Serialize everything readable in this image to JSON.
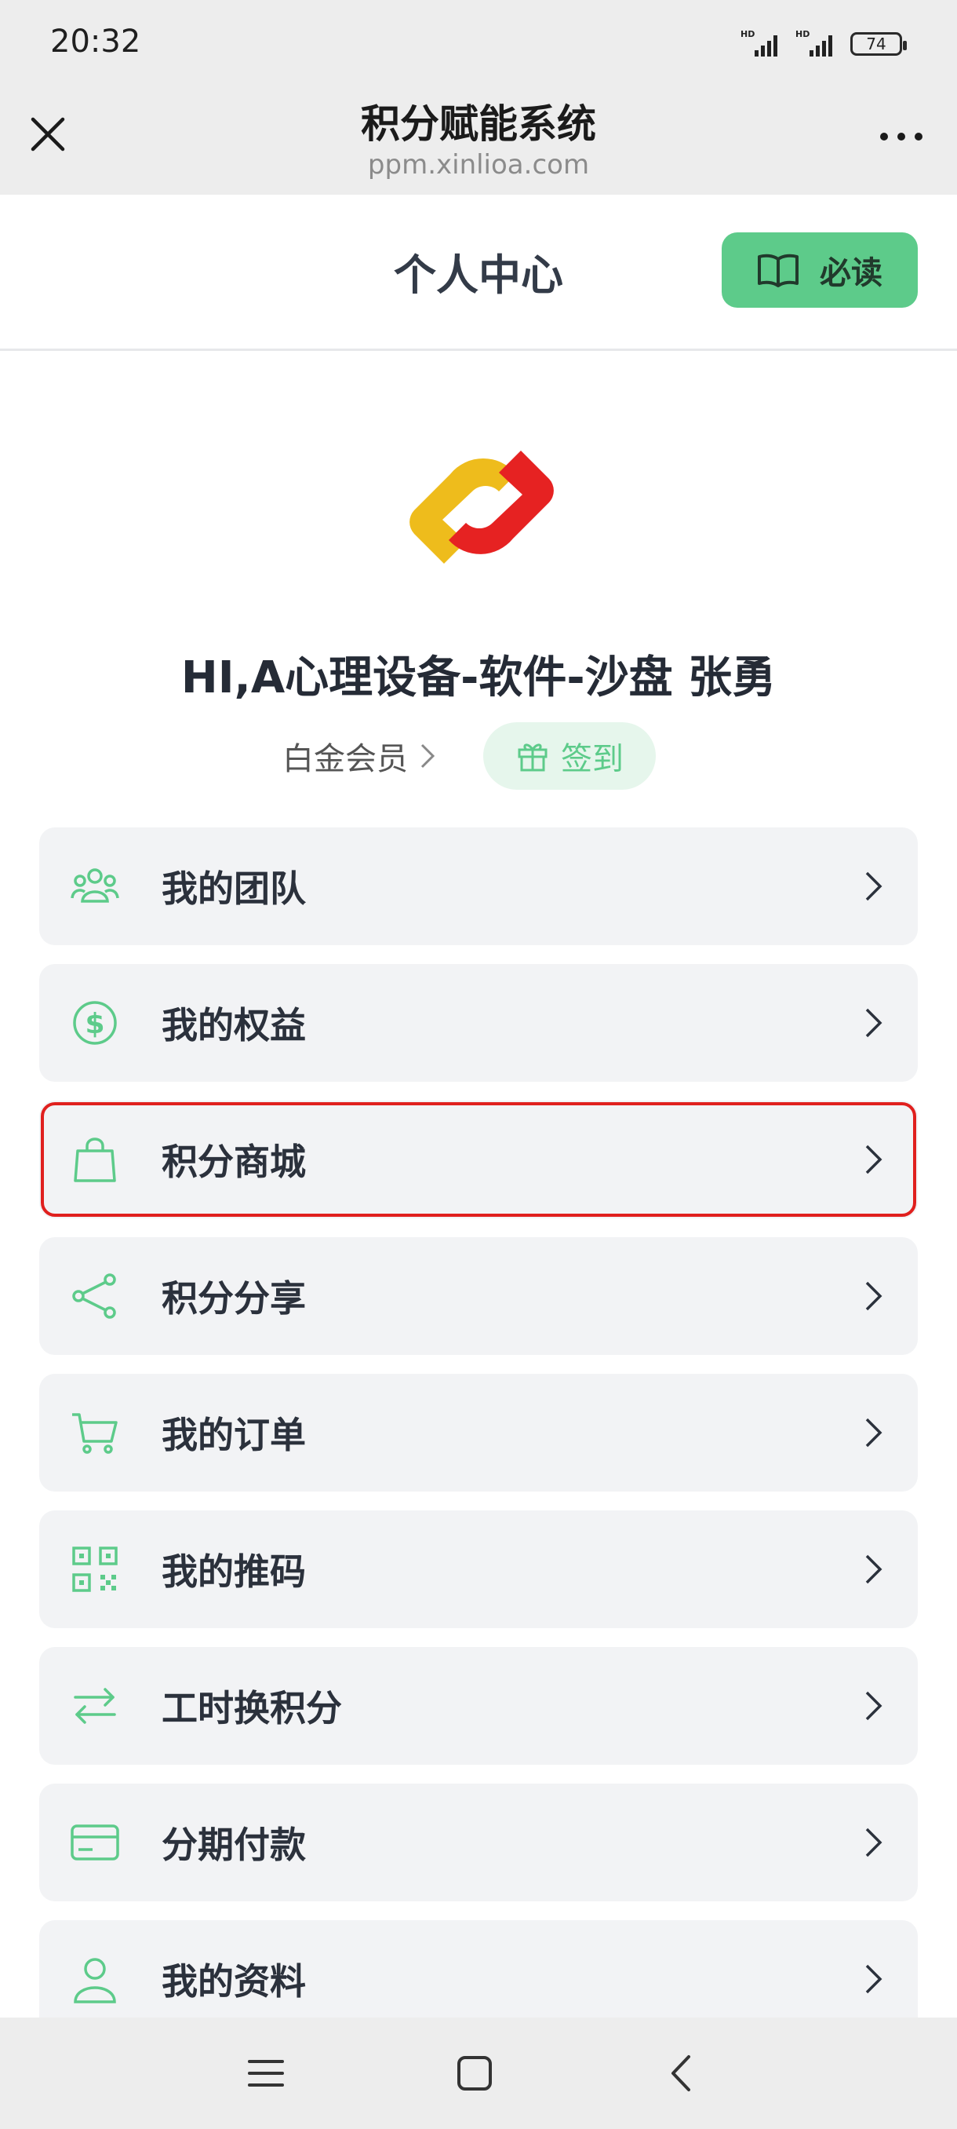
{
  "status_bar": {
    "time": "20:32",
    "battery_level": "74"
  },
  "browser": {
    "title": "积分赋能系统",
    "url": "ppm.xinlioa.com",
    "close_icon": "close-icon",
    "more_icon": "more-icon"
  },
  "header": {
    "title": "个人中心",
    "must_read_label": "必读",
    "must_read_icon": "book-icon"
  },
  "profile": {
    "greeting": "HI,A心理设备-软件-沙盘 张勇",
    "member_level": "白金会员",
    "checkin_label": "签到",
    "checkin_icon": "gift-icon"
  },
  "menu": [
    {
      "label": "我的团队",
      "icon": "team-icon"
    },
    {
      "label": "我的权益",
      "icon": "dollar-icon"
    },
    {
      "label": "积分商城",
      "icon": "shopping-bag-icon",
      "highlighted": true
    },
    {
      "label": "积分分享",
      "icon": "share-icon"
    },
    {
      "label": "我的订单",
      "icon": "cart-icon"
    },
    {
      "label": "我的推码",
      "icon": "qr-code-icon"
    },
    {
      "label": "工时换积分",
      "icon": "exchange-icon"
    },
    {
      "label": "分期付款",
      "icon": "credit-card-icon"
    },
    {
      "label": "我的资料",
      "icon": "user-icon"
    }
  ],
  "colors": {
    "accent": "#5dcb8a",
    "highlight_border": "#e0201e",
    "card_bg": "#f2f3f5"
  }
}
